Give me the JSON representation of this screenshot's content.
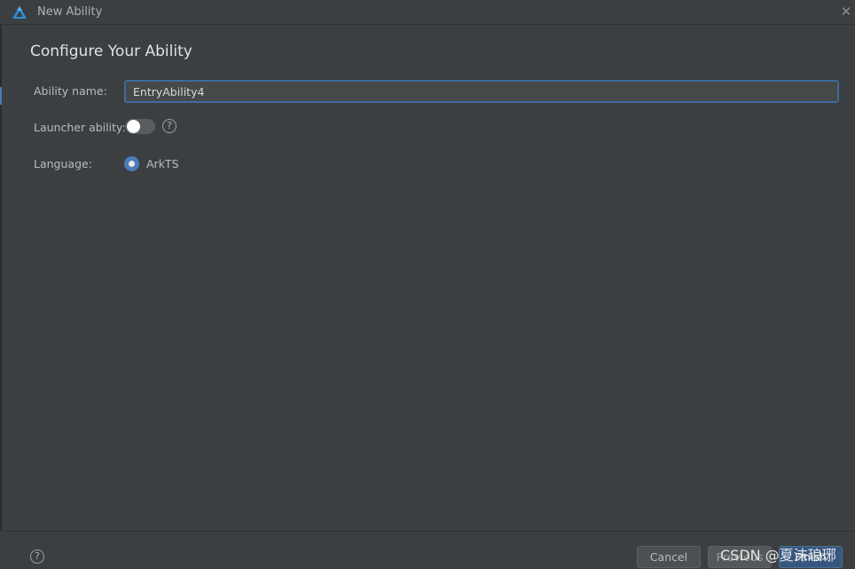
{
  "window": {
    "title": "New Ability",
    "app_icon": "deveco-logo-icon",
    "close_icon": "close-icon"
  },
  "form": {
    "heading": "Configure Your Ability",
    "ability_name_label": "Ability name:",
    "ability_name_value": "EntryAbility4",
    "launcher_label": "Launcher ability:",
    "launcher_enabled": false,
    "language_label": "Language:",
    "language_option": "ArkTS",
    "language_selected": true
  },
  "footer": {
    "cancel_label": "Cancel",
    "previous_label": "Previous",
    "finish_label": "Finish"
  },
  "watermark": {
    "text": "CSDN @夏沫琅琊"
  },
  "colors": {
    "background": "#3c3f41",
    "accent": "#4b7bb9",
    "input_border": "#3f6b9b",
    "finish_button": "#365880"
  }
}
